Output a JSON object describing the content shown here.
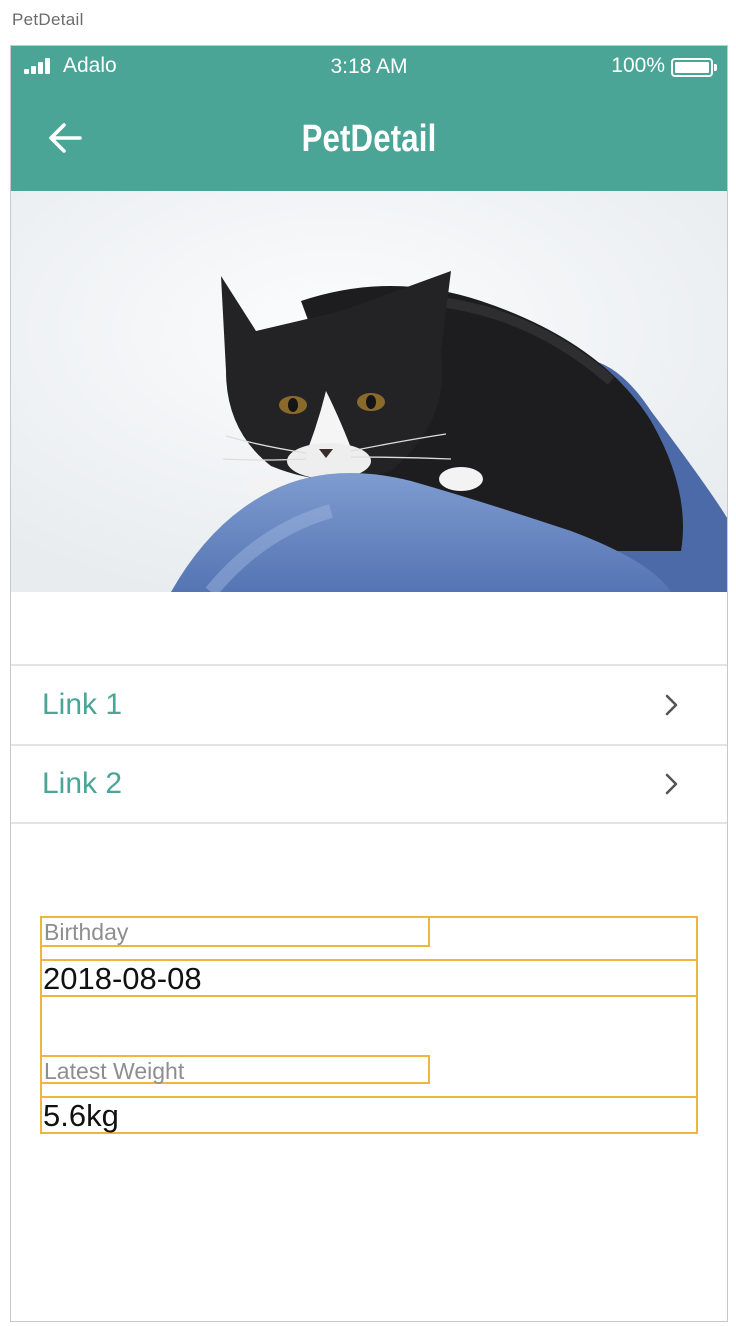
{
  "window": {
    "title": "PetDetail"
  },
  "status_bar": {
    "carrier": "Adalo",
    "time": "3:18 AM",
    "battery": "100%"
  },
  "header": {
    "title": "PetDetail",
    "back_icon": "arrow-left-icon"
  },
  "hero": {
    "image": "black-and-white-cat-photo"
  },
  "links": [
    {
      "label": "Link 1",
      "icon": "chevron-right-icon"
    },
    {
      "label": "Link 2",
      "icon": "chevron-right-icon"
    }
  ],
  "fields": {
    "birthday": {
      "label": "Birthday",
      "value": "2018-08-08"
    },
    "weight": {
      "label": "Latest Weight",
      "value": "5.6kg"
    }
  },
  "colors": {
    "accent": "#4aa596",
    "selection": "#f0b541",
    "label_gray": "#8e8e8e"
  }
}
